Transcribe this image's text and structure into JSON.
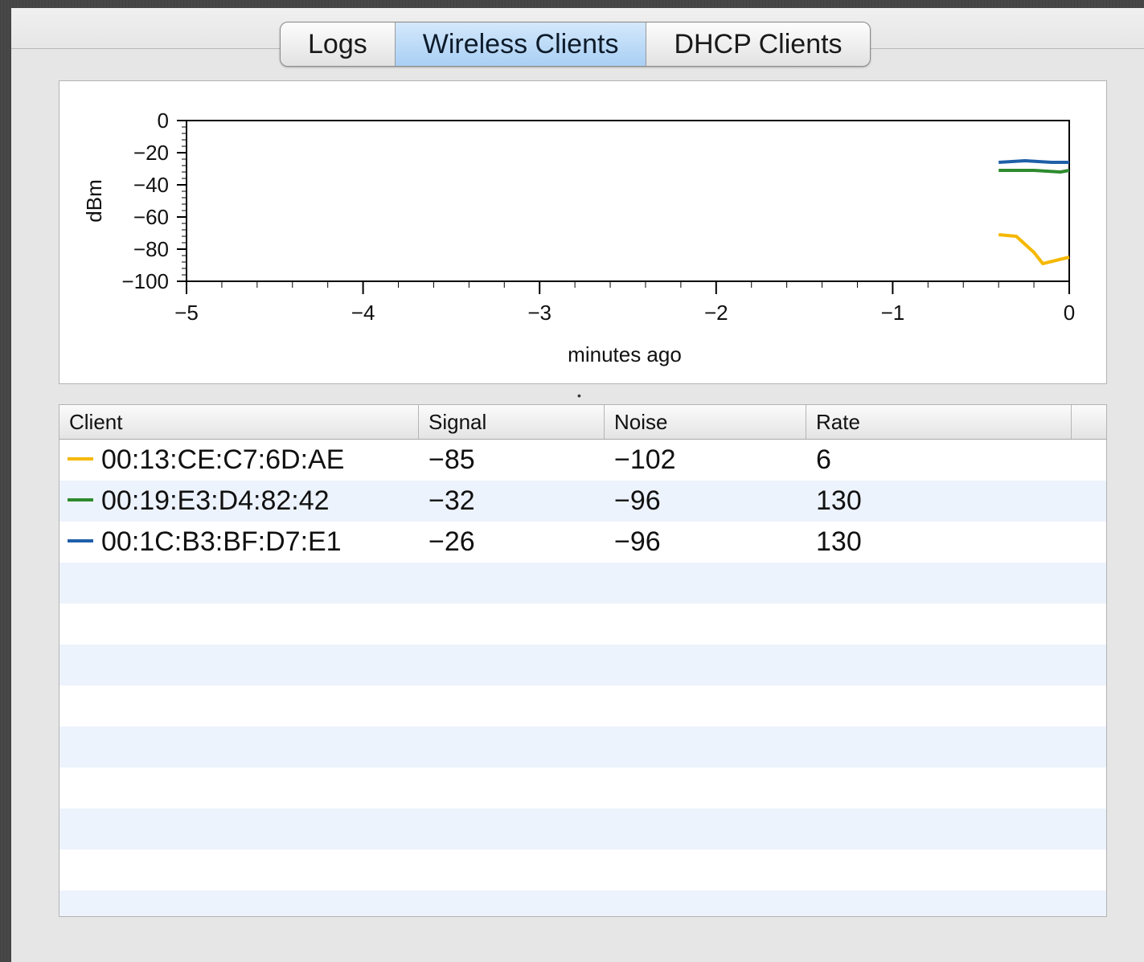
{
  "tabs": [
    {
      "label": "Logs",
      "active": false
    },
    {
      "label": "Wireless Clients",
      "active": true
    },
    {
      "label": "DHCP Clients",
      "active": false
    }
  ],
  "chart_data": {
    "type": "line",
    "xlabel": "minutes ago",
    "ylabel": "dBm",
    "xlim": [
      -5,
      0
    ],
    "ylim": [
      -100,
      0
    ],
    "x_ticks": [
      "-5",
      "-4",
      "-3",
      "-2",
      "-1",
      "0"
    ],
    "y_ticks": [
      "0",
      "-20",
      "-40",
      "-60",
      "-80",
      "-100"
    ],
    "grid": false,
    "series": [
      {
        "name": "00:1C:B3:BF:D7:E1",
        "color": "#1f5fa8",
        "x": [
          -0.4,
          -0.25,
          -0.1,
          0
        ],
        "y": [
          -26,
          -25,
          -26,
          -26
        ]
      },
      {
        "name": "00:19:E3:D4:82:42",
        "color": "#2e8b2e",
        "x": [
          -0.4,
          -0.2,
          -0.05,
          0
        ],
        "y": [
          -31,
          -31,
          -32,
          -31
        ]
      },
      {
        "name": "00:13:CE:C7:6D:AE",
        "color": "#f5b800",
        "x": [
          -0.4,
          -0.3,
          -0.2,
          -0.15,
          0
        ],
        "y": [
          -71,
          -72,
          -82,
          -89,
          -85
        ]
      }
    ]
  },
  "splitter_glyph": "•",
  "table": {
    "columns": [
      "Client",
      "Signal",
      "Noise",
      "Rate",
      ""
    ],
    "rows": [
      {
        "client": "00:13:CE:C7:6D:AE",
        "color": "#f5b800",
        "signal": "-85",
        "noise": "-102",
        "rate": "6"
      },
      {
        "client": "00:19:E3:D4:82:42",
        "color": "#2e8b2e",
        "signal": "-32",
        "noise": "-96",
        "rate": "130"
      },
      {
        "client": "00:1C:B3:BF:D7:E1",
        "color": "#1f5fa8",
        "signal": "-26",
        "noise": "-96",
        "rate": "130"
      }
    ]
  }
}
